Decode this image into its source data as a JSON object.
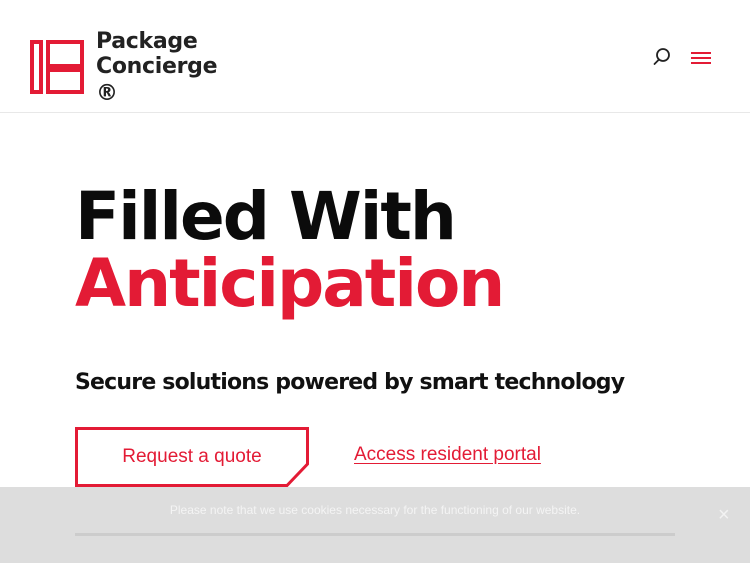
{
  "header": {
    "logo": {
      "line1": "Package",
      "line2": "Concierge",
      "registered": "®"
    },
    "icons": {
      "search": "search-icon",
      "menu": "hamburger-menu-icon"
    }
  },
  "hero": {
    "title_line1": "Filled With",
    "title_line2": "Anticipation",
    "subtitle": "Secure solutions powered by smart technology",
    "primary_cta": "Request a quote",
    "secondary_link": "Access resident portal"
  },
  "cookie_banner": {
    "text": "Please note that we use cookies necessary for the functioning of our website.",
    "accept_label": "",
    "close_glyph": "×"
  },
  "colors": {
    "brand_red": "#e31b35",
    "text_dark": "#111111",
    "cookie_bg": "#dadada"
  }
}
